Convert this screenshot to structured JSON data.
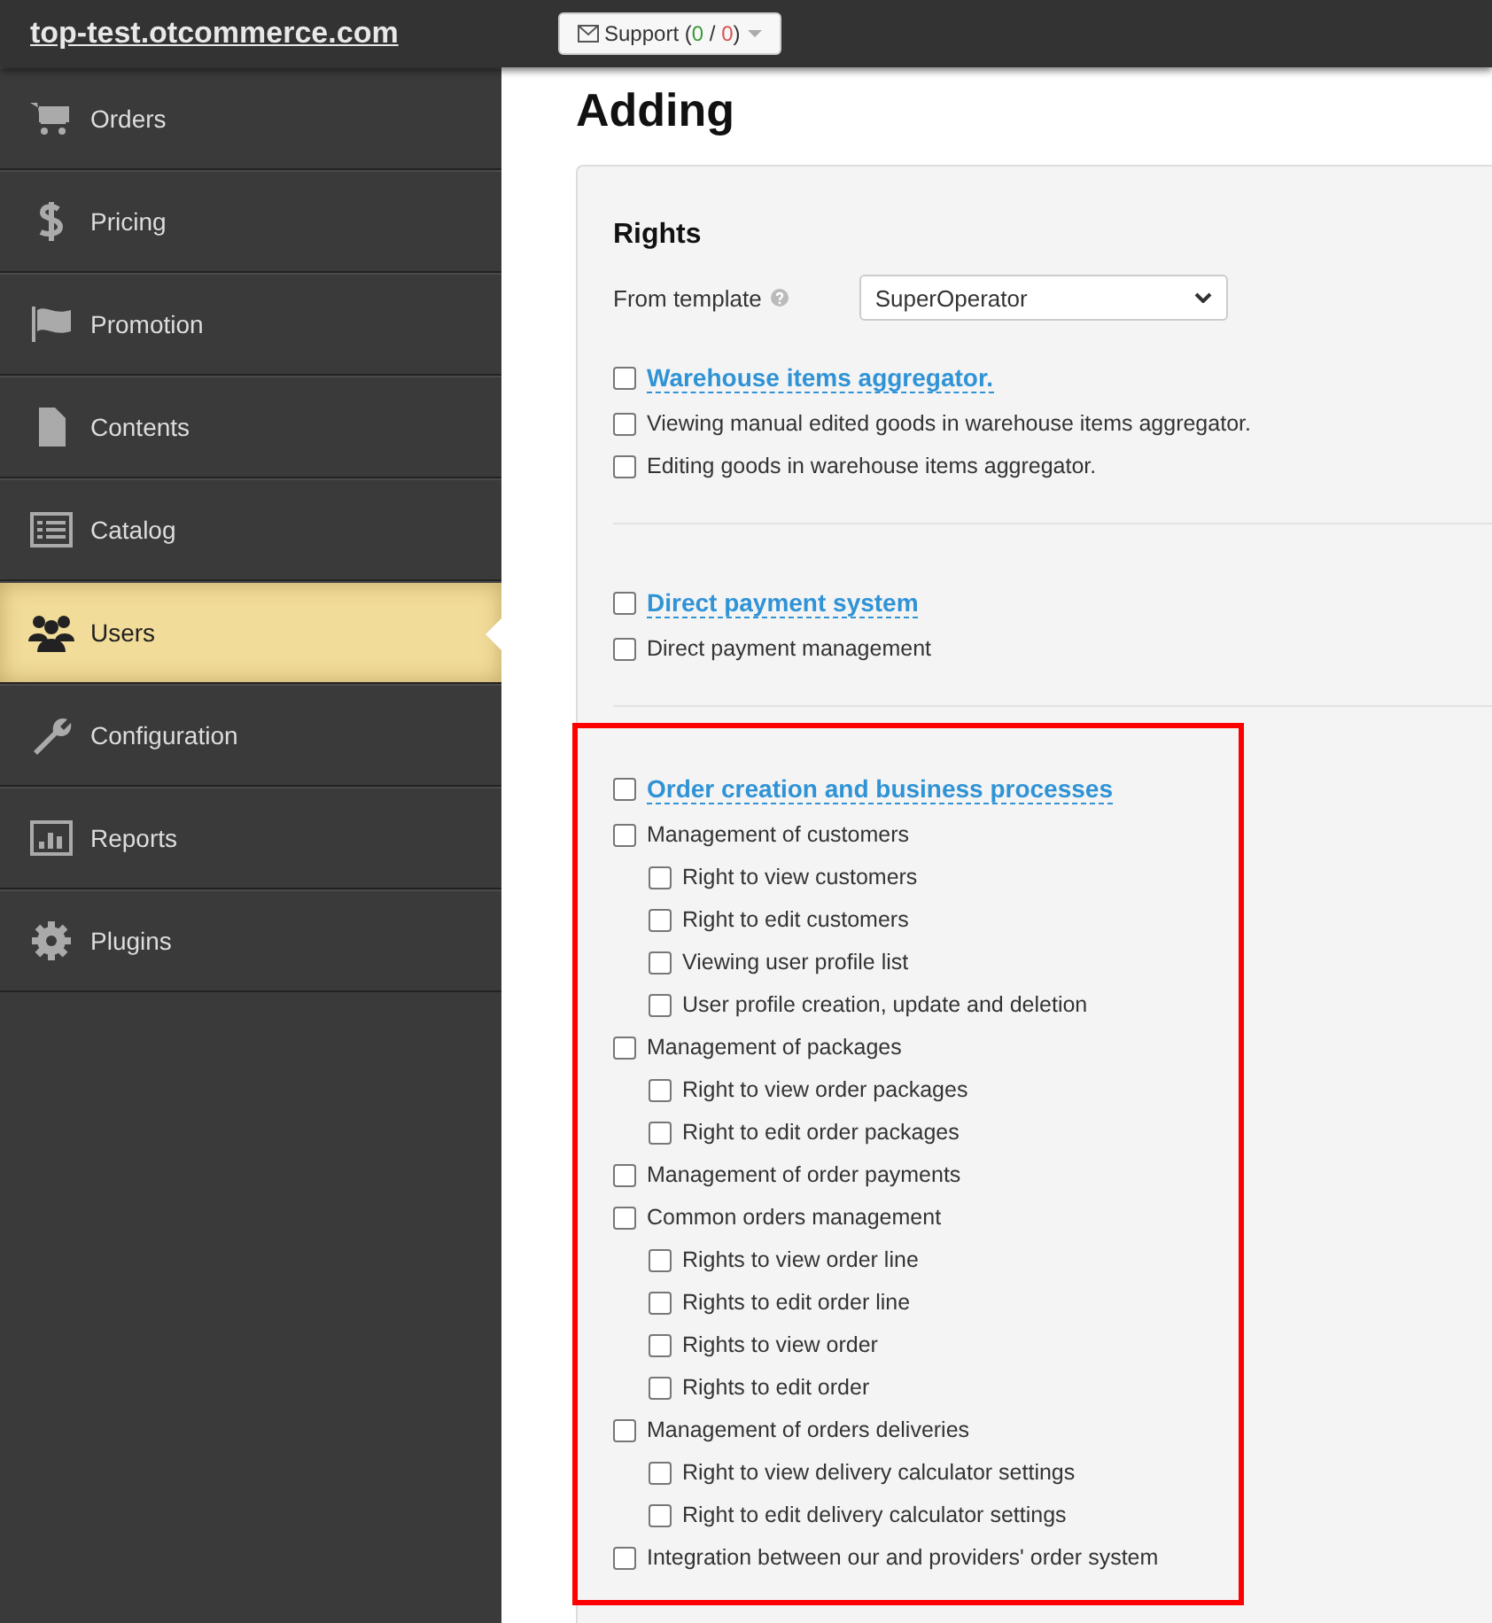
{
  "site_title": "top-test.otcommerce.com",
  "support_button": {
    "parts": [
      {
        "text": "Support (",
        "color": "#333333"
      },
      {
        "text": "0",
        "color": "#3a9a3a"
      },
      {
        "text": " / ",
        "color": "#333333"
      },
      {
        "text": "0",
        "color": "#d9534f"
      },
      {
        "text": ")",
        "color": "#333333"
      }
    ]
  },
  "sidebar": {
    "items": [
      {
        "label": "Orders",
        "kind": "cart",
        "selected": false
      },
      {
        "label": "Pricing",
        "kind": "dollar",
        "selected": false
      },
      {
        "label": "Promotion",
        "kind": "flag",
        "selected": false
      },
      {
        "label": "Contents",
        "kind": "file",
        "selected": false
      },
      {
        "label": "Catalog",
        "kind": "list",
        "selected": false
      },
      {
        "label": "Users",
        "kind": "users",
        "selected": true
      },
      {
        "label": "Configuration",
        "kind": "wrench",
        "selected": false
      },
      {
        "label": "Reports",
        "kind": "chart",
        "selected": false
      },
      {
        "label": "Plugins",
        "kind": "gear",
        "selected": false
      }
    ]
  },
  "page_title": "Adding",
  "rights": {
    "title": "Rights",
    "template_label": "From template",
    "template_value": "SuperOperator",
    "sections": [
      {
        "title": "Warehouse items aggregator.",
        "checked": false,
        "highlighted": false,
        "items": [
          {
            "label": "Viewing manual edited goods in warehouse items aggregator.",
            "checked": false
          },
          {
            "label": "Editing goods in warehouse items aggregator.",
            "checked": false
          }
        ]
      },
      {
        "title": "Direct payment system",
        "checked": false,
        "highlighted": false,
        "items": [
          {
            "label": "Direct payment management",
            "checked": false
          }
        ]
      },
      {
        "title": "Order creation and business processes",
        "checked": false,
        "highlighted": true,
        "items": [
          {
            "label": "Management of customers",
            "checked": false,
            "children": [
              {
                "label": "Right to view customers",
                "checked": false
              },
              {
                "label": "Right to edit customers",
                "checked": false
              },
              {
                "label": "Viewing user profile list",
                "checked": false
              },
              {
                "label": "User profile creation, update and deletion",
                "checked": false
              }
            ]
          },
          {
            "label": "Management of packages",
            "checked": false,
            "children": [
              {
                "label": "Right to view order packages",
                "checked": false
              },
              {
                "label": "Right to edit order packages",
                "checked": false
              }
            ]
          },
          {
            "label": "Management of order payments",
            "checked": false
          },
          {
            "label": "Common orders management",
            "checked": false,
            "children": [
              {
                "label": "Rights to view order line",
                "checked": false
              },
              {
                "label": "Rights to edit order line",
                "checked": false
              },
              {
                "label": "Rights to view order",
                "checked": false
              },
              {
                "label": "Rights to edit order",
                "checked": false
              }
            ]
          },
          {
            "label": "Management of orders deliveries",
            "checked": false,
            "children": [
              {
                "label": "Right to view delivery calculator settings",
                "checked": false
              },
              {
                "label": "Right to edit delivery calculator settings",
                "checked": false
              }
            ]
          },
          {
            "label": "Integration between our and providers' order system",
            "checked": false
          }
        ]
      }
    ]
  }
}
